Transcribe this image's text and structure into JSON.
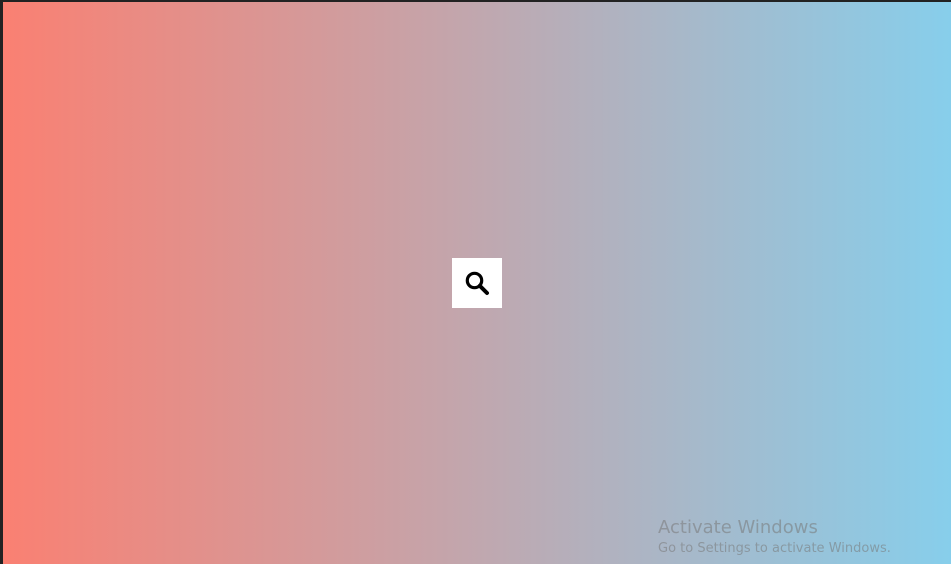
{
  "page": {
    "gradient_start": "#fa8072",
    "gradient_end": "#87ceeb",
    "frame_color": "#222222"
  },
  "search": {
    "icon": "search-icon",
    "background": "#ffffff",
    "icon_color": "#000000"
  },
  "watermark": {
    "title": "Activate Windows",
    "subtitle": "Go to Settings to activate Windows."
  }
}
